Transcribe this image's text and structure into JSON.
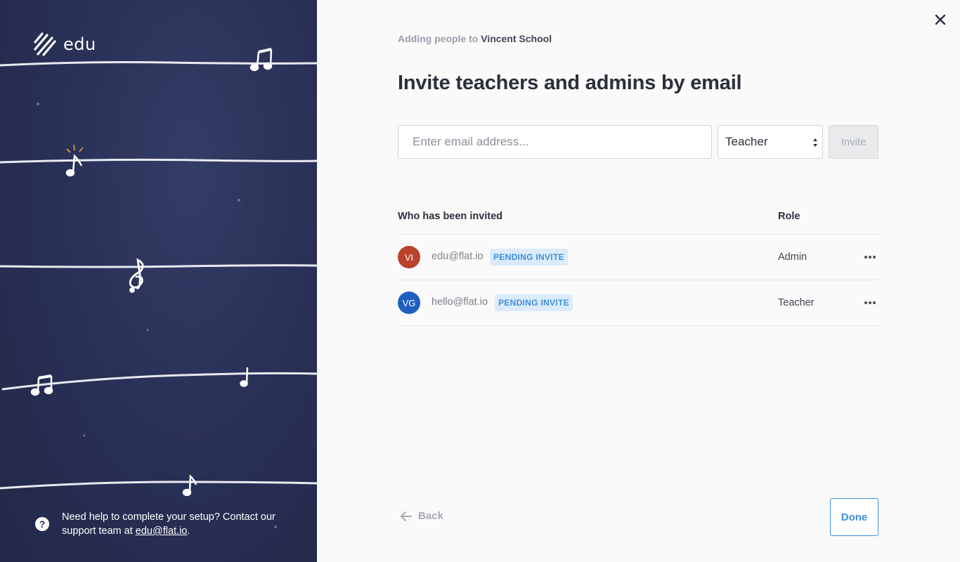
{
  "brand": {
    "logo_text": "edu",
    "logo_icon": "stripes-logo-icon"
  },
  "help": {
    "text": "Need help to complete your setup? Contact our support team at ",
    "email_link": "edu@flat.io",
    "suffix": "."
  },
  "header": {
    "subtitle_prefix": "Adding people to",
    "school_name": "Vincent School",
    "title": "Invite teachers and admins by email"
  },
  "invite_form": {
    "email_placeholder": "Enter email address...",
    "email_value": "",
    "role_selected": "Teacher",
    "invite_label": "Invite"
  },
  "invited_table": {
    "headers": {
      "who": "Who has been invited",
      "role": "Role"
    },
    "rows": [
      {
        "initials": "VI",
        "avatar_color": "#b9432c",
        "email": "edu@flat.io",
        "status": "PENDING INVITE",
        "role": "Admin"
      },
      {
        "initials": "VG",
        "avatar_color": "#1f5fbf",
        "email": "hello@flat.io",
        "status": "PENDING INVITE",
        "role": "Teacher"
      }
    ]
  },
  "footer": {
    "back_label": "Back",
    "done_label": "Done"
  },
  "colors": {
    "accent": "#3f8fd9",
    "panel_bg": "#2a3158",
    "badge_bg": "#dcebfa"
  }
}
